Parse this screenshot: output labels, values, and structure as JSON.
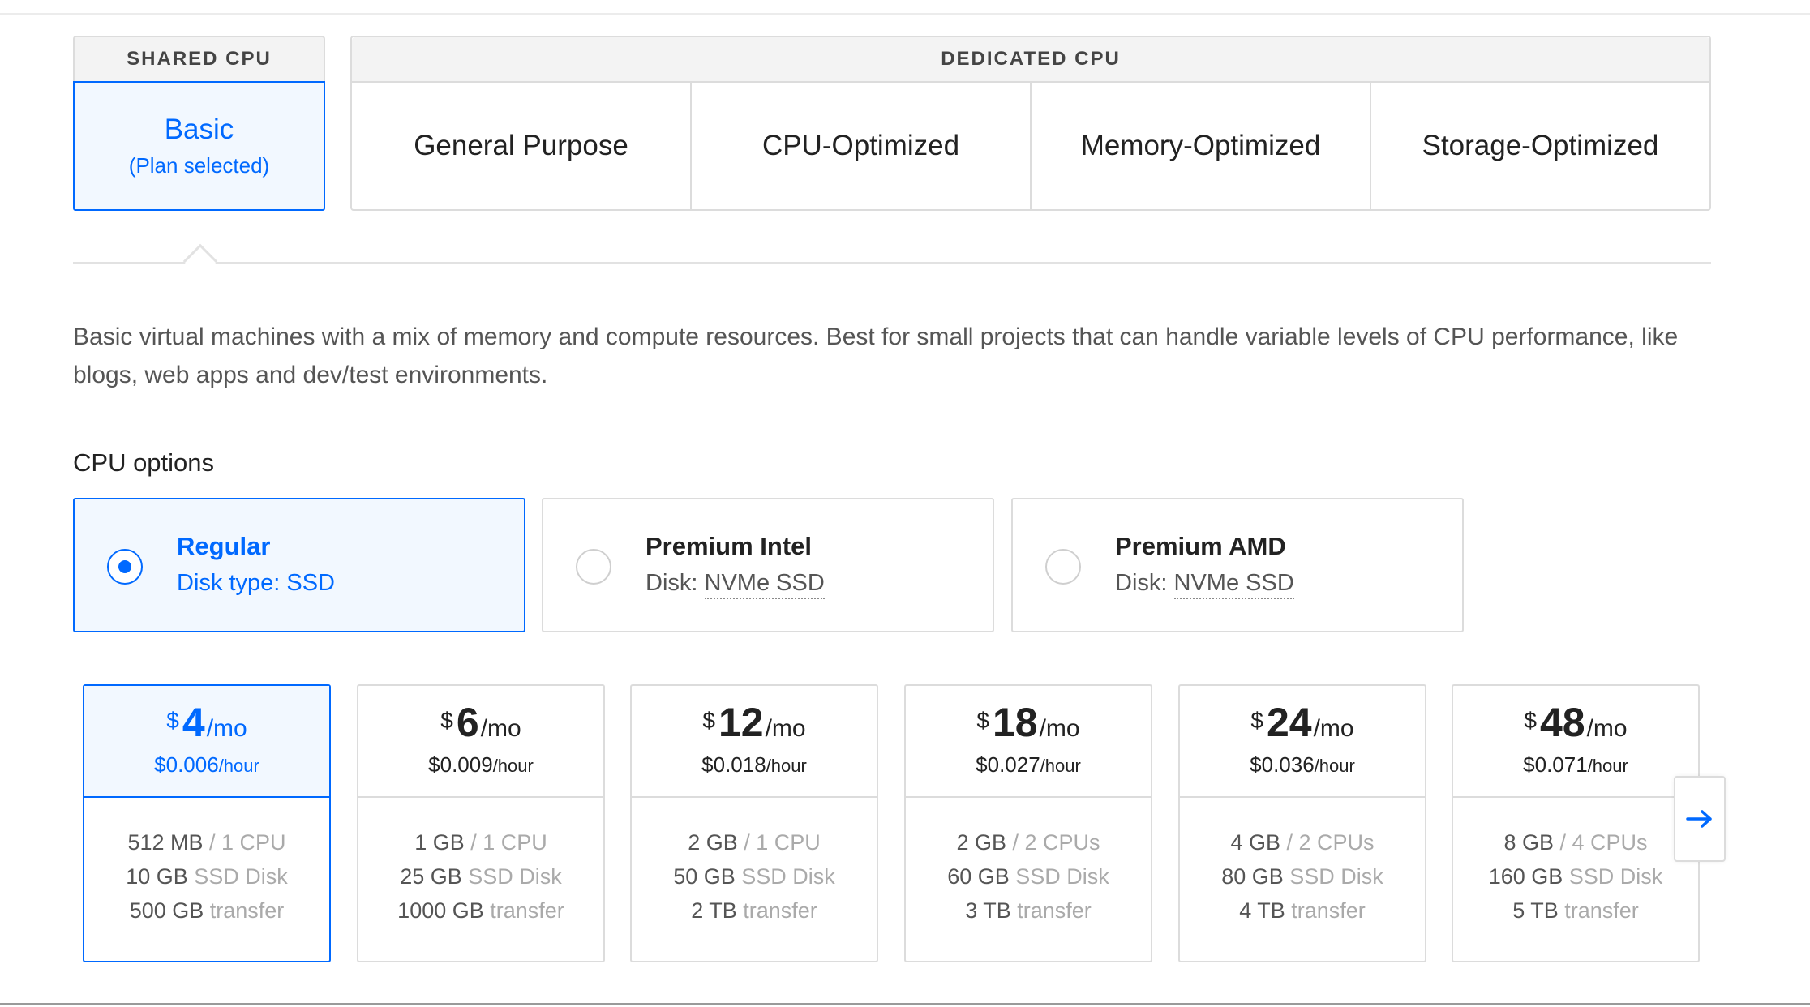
{
  "plan_groups": {
    "shared": {
      "header": "SHARED CPU",
      "tab": {
        "label": "Basic",
        "sub": "(Plan selected)"
      }
    },
    "dedicated": {
      "header": "DEDICATED CPU",
      "tabs": [
        "General Purpose",
        "CPU-Optimized",
        "Memory-Optimized",
        "Storage-Optimized"
      ]
    }
  },
  "description": "Basic virtual machines with a mix of memory and compute resources. Best for small projects that can handle variable levels of CPU performance, like blogs, web apps and dev/test environments.",
  "cpu_options": {
    "title": "CPU options",
    "options": [
      {
        "title": "Regular",
        "disk_prefix": "Disk type: ",
        "disk": "SSD",
        "selected": true
      },
      {
        "title": "Premium Intel",
        "disk_prefix": "Disk: ",
        "disk": "NVMe SSD",
        "selected": false
      },
      {
        "title": "Premium AMD",
        "disk_prefix": "Disk: ",
        "disk": "NVMe SSD",
        "selected": false
      }
    ]
  },
  "plans": [
    {
      "currency": "$",
      "amount": "4",
      "per": "/mo",
      "hourly": "$0.006",
      "hourly_unit": "/hour",
      "memory": "512 MB",
      "cpu": "/ 1 CPU",
      "disk": "10 GB",
      "disk_label": "SSD Disk",
      "transfer": "500 GB",
      "transfer_label": "transfer",
      "selected": true
    },
    {
      "currency": "$",
      "amount": "6",
      "per": "/mo",
      "hourly": "$0.009",
      "hourly_unit": "/hour",
      "memory": "1 GB",
      "cpu": "/ 1 CPU",
      "disk": "25 GB",
      "disk_label": "SSD Disk",
      "transfer": "1000 GB",
      "transfer_label": "transfer",
      "selected": false
    },
    {
      "currency": "$",
      "amount": "12",
      "per": "/mo",
      "hourly": "$0.018",
      "hourly_unit": "/hour",
      "memory": "2 GB",
      "cpu": "/ 1 CPU",
      "disk": "50 GB",
      "disk_label": "SSD Disk",
      "transfer": "2 TB",
      "transfer_label": "transfer",
      "selected": false
    },
    {
      "currency": "$",
      "amount": "18",
      "per": "/mo",
      "hourly": "$0.027",
      "hourly_unit": "/hour",
      "memory": "2 GB",
      "cpu": "/ 2 CPUs",
      "disk": "60 GB",
      "disk_label": "SSD Disk",
      "transfer": "3 TB",
      "transfer_label": "transfer",
      "selected": false
    },
    {
      "currency": "$",
      "amount": "24",
      "per": "/mo",
      "hourly": "$0.036",
      "hourly_unit": "/hour",
      "memory": "4 GB",
      "cpu": "/ 2 CPUs",
      "disk": "80 GB",
      "disk_label": "SSD Disk",
      "transfer": "4 TB",
      "transfer_label": "transfer",
      "selected": false
    },
    {
      "currency": "$",
      "amount": "48",
      "per": "/mo",
      "hourly": "$0.071",
      "hourly_unit": "/hour",
      "memory": "8 GB",
      "cpu": "/ 4 CPUs",
      "disk": "160 GB",
      "disk_label": "SSD Disk",
      "transfer": "5 TB",
      "transfer_label": "transfer",
      "selected": false
    }
  ],
  "icons": {
    "next": "arrow-right-icon"
  },
  "colors": {
    "accent": "#0069ff",
    "selected_bg": "#f2f8ff",
    "border": "#dcdcdc"
  }
}
